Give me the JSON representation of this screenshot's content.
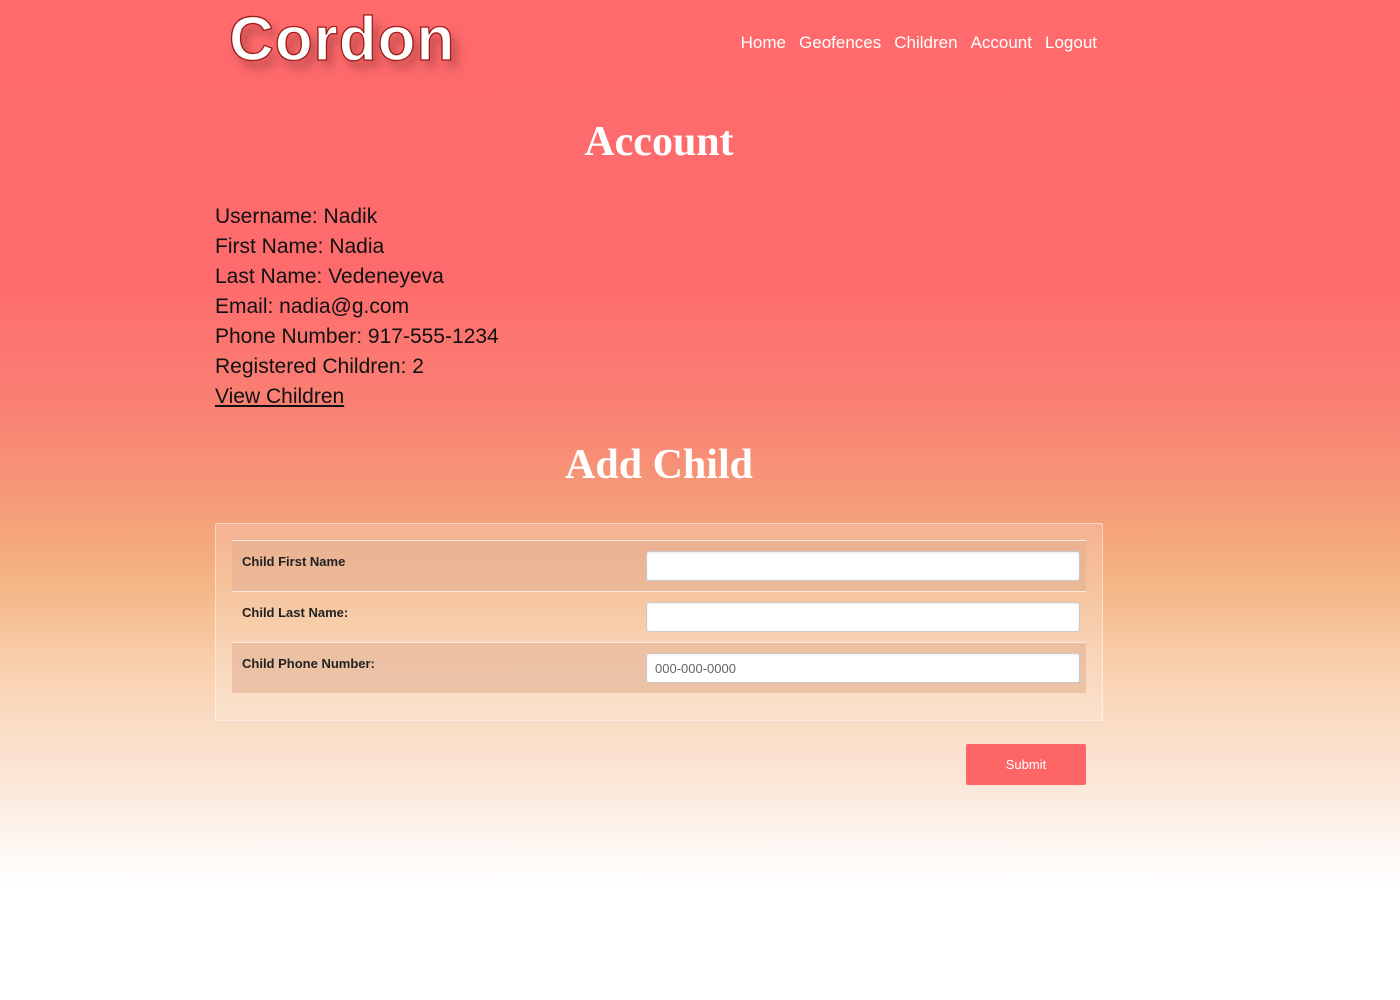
{
  "header": {
    "logo": "Cordon",
    "nav": [
      "Home",
      "Geofences",
      "Children",
      "Account",
      "Logout"
    ]
  },
  "account": {
    "title": "Account",
    "username": "Username: Nadik",
    "first_name": "First Name: Nadia",
    "last_name": "Last Name: Vedeneyeva",
    "email": "Email: nadia@g.com",
    "phone": "Phone Number: 917-555-1234",
    "registered_children": "Registered Children: 2",
    "view_children_link": "View Children"
  },
  "add_child": {
    "title": "Add Child",
    "fields": [
      {
        "label": "Child First Name",
        "value": "",
        "placeholder": ""
      },
      {
        "label": "Child Last Name:",
        "value": "",
        "placeholder": ""
      },
      {
        "label": "Child Phone Number:",
        "value": "",
        "placeholder": "000-000-0000"
      }
    ],
    "submit_label": "Submit"
  },
  "colors": {
    "brand": "#fd6567",
    "gradient_top": "#ff6b6d",
    "gradient_mid": "#f4b483",
    "gradient_bottom": "#ffffff"
  }
}
